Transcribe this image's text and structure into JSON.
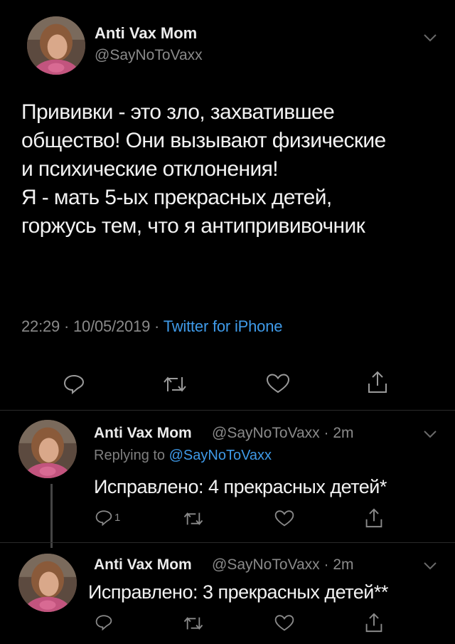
{
  "tweet": {
    "author_name": "Anti Vax Mom",
    "author_handle": "@SayNoToVaxx",
    "body_lines": [
      "Прививки - это зло, захватившее",
      "общество! Они вызывают физические",
      "и психические отклонения!",
      "Я - мать 5-ых прекрасных детей,",
      "горжусь тем, что я антипрививочник"
    ],
    "time": "22:29",
    "date": "10/05/2019",
    "separator": " · ",
    "source": "Twitter for iPhone"
  },
  "replies": [
    {
      "author_name": "Anti Vax Mom",
      "author_handle_time": "@SayNoToVaxx · 2m",
      "replying_prefix": "Replying to ",
      "replying_handle": "@SayNoToVaxx",
      "text": "Исправлено: 4 прекрасных детей*",
      "reply_count": "1"
    },
    {
      "author_name": "Anti Vax Mom",
      "author_handle_time": "@SayNoToVaxx · 2m",
      "text": "Исправлено: 3 прекрасных детей**"
    }
  ],
  "icons": [
    "avatar",
    "chevron-down-icon",
    "reply-icon",
    "retweet-icon",
    "like-icon",
    "share-icon"
  ],
  "colors": {
    "background": "#000000",
    "text": "#f2f2f2",
    "muted": "#8a8a8a",
    "link": "#3f9ae8"
  }
}
